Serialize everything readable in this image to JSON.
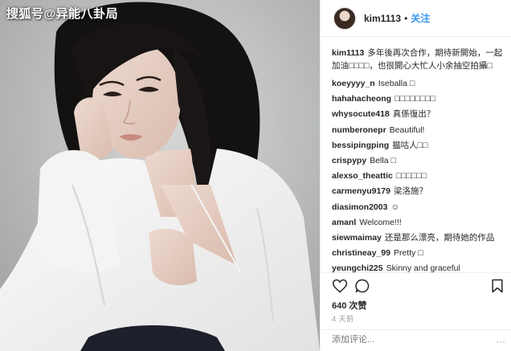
{
  "watermark": "搜狐号@异能八卦局",
  "header": {
    "username": "kim1113",
    "separator": "•",
    "follow": "关注"
  },
  "caption": {
    "username": "kim1113",
    "text": "多年後再次合作，期待新開始，一起加油□□□□，也很開心大忙人小余抽空拍攝□"
  },
  "comments": [
    {
      "username": "koeyyyy_n",
      "text": "Iseballa □"
    },
    {
      "username": "hahahacheong",
      "text": "□□□□□□□□"
    },
    {
      "username": "whysocute418",
      "text": "真係復出？"
    },
    {
      "username": "numberonepr",
      "text": "Beautiful!"
    },
    {
      "username": "bessipingping",
      "text": "揾咕人□□"
    },
    {
      "username": "crispypy",
      "text": "Bella □"
    },
    {
      "username": "alexso_theattic",
      "text": "□□□□□□"
    },
    {
      "username": "carmenyu9179",
      "text": "梁洛施？"
    },
    {
      "username": "diasimon2003",
      "text": "☺"
    },
    {
      "username": "amanl",
      "text": "Welcome!!!"
    },
    {
      "username": "siewmaimay",
      "text": "还是那么漂亮，期待她的作品"
    },
    {
      "username": "christineay_99",
      "text": "Pretty □"
    },
    {
      "username": "yeungchi225",
      "text": "Skinny and graceful"
    }
  ],
  "actions": {
    "icons": [
      "heart-icon",
      "comment-icon",
      "bookmark-icon"
    ]
  },
  "likes": "640 次赞",
  "time": "4 天前",
  "add_comment": {
    "placeholder": "添加评论..."
  },
  "more": "···",
  "colors": {
    "link": "#3897f0",
    "text": "#262626",
    "muted": "#999999",
    "border": "#efefef"
  }
}
